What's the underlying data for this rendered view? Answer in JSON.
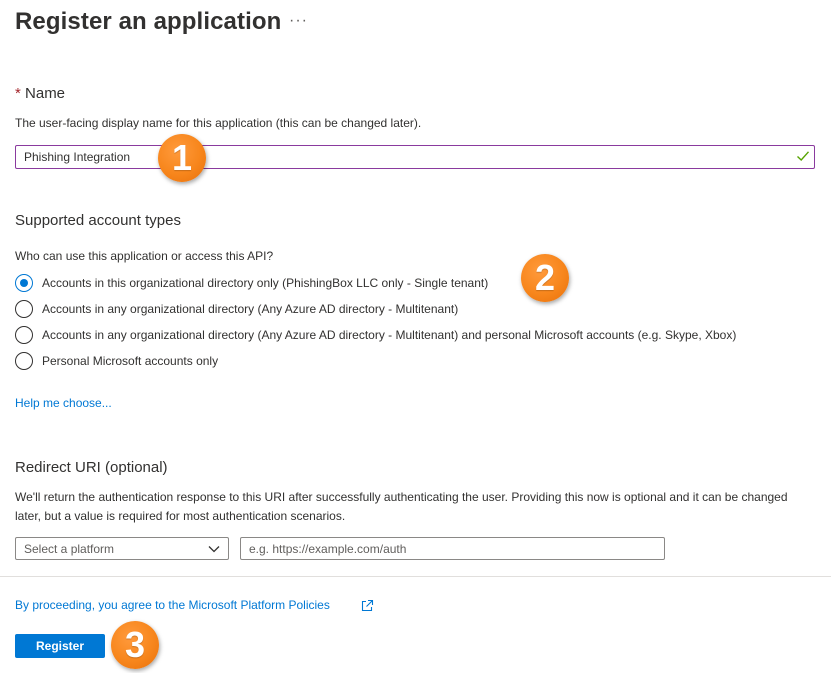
{
  "page": {
    "title": "Register an application",
    "more_label": "···"
  },
  "name_section": {
    "required_mark": "*",
    "label": "Name",
    "description": "The user-facing display name for this application (this can be changed later).",
    "value": "Phishing Integration",
    "valid": true
  },
  "account_types": {
    "label": "Supported account types",
    "question": "Who can use this application or access this API?",
    "options": [
      {
        "label": "Accounts in this organizational directory only (PhishingBox LLC only - Single tenant)",
        "checked": true
      },
      {
        "label": "Accounts in any organizational directory (Any Azure AD directory - Multitenant)",
        "checked": false
      },
      {
        "label": "Accounts in any organizational directory (Any Azure AD directory - Multitenant) and personal Microsoft accounts (e.g. Skype, Xbox)",
        "checked": false
      },
      {
        "label": "Personal Microsoft accounts only",
        "checked": false
      }
    ],
    "help_link": "Help me choose..."
  },
  "redirect_uri": {
    "label": "Redirect URI (optional)",
    "description": "We'll return the authentication response to this URI after successfully authenticating the user. Providing this now is optional and it can be changed later, but a value is required for most authentication scenarios.",
    "platform_placeholder": "Select a platform",
    "uri_placeholder": "e.g. https://example.com/auth"
  },
  "footer": {
    "policy_link": "By proceeding, you agree to the Microsoft Platform Policies",
    "register_label": "Register"
  },
  "callouts": [
    "1",
    "2",
    "3"
  ],
  "colors": {
    "accent": "#0078d4",
    "callout": "#f7861c",
    "valid_check": "#57a300",
    "input_focus_border": "#8a3a9e"
  }
}
